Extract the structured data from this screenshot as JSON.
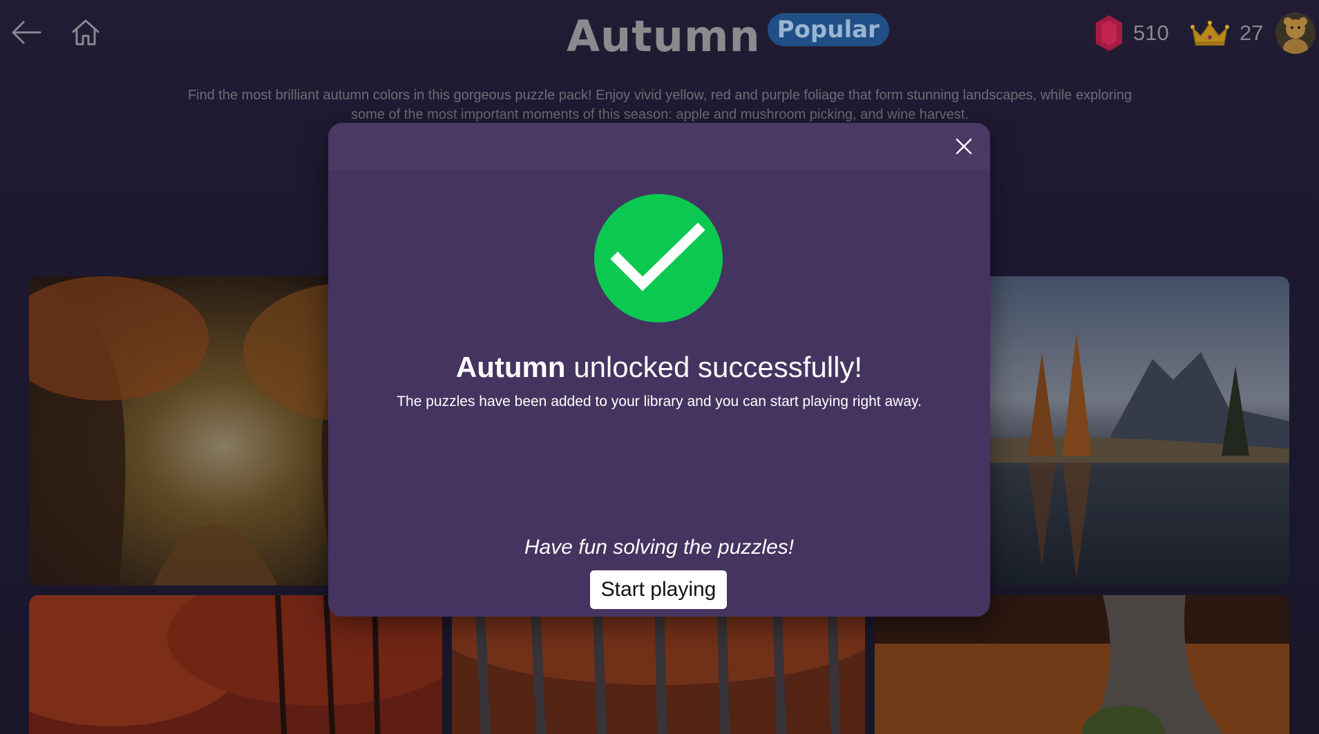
{
  "header": {
    "title": "Autumn",
    "badge": "Popular",
    "gems": "510",
    "crowns": "27",
    "back_icon": "back-arrow-icon",
    "home_icon": "home-icon",
    "gem_icon": "gem-icon",
    "crown_icon": "crown-icon",
    "avatar_icon": "avatar"
  },
  "pack": {
    "description": "Find the most brilliant autumn colors in this gorgeous puzzle pack! Enjoy vivid yellow, red and purple foliage that form stunning landscapes, while exploring some of the most important moments of this season: apple and mushroom picking, and wine harvest."
  },
  "dialog": {
    "title_bold": "Autumn",
    "title_rest": " unlocked successfully!",
    "message": "The puzzles have been added to your library and you can start playing right away.",
    "fun_text": "Have fun solving the puzzles!",
    "start_label": "Start playing",
    "close_icon": "close-icon",
    "success_icon": "checkmark-circle-icon"
  },
  "colors": {
    "background": "#1c1830",
    "dialog": "#453460",
    "badge": "#1f4f86",
    "success": "#0bc851",
    "gem": "#b01a44",
    "crown": "#b98a1c"
  }
}
